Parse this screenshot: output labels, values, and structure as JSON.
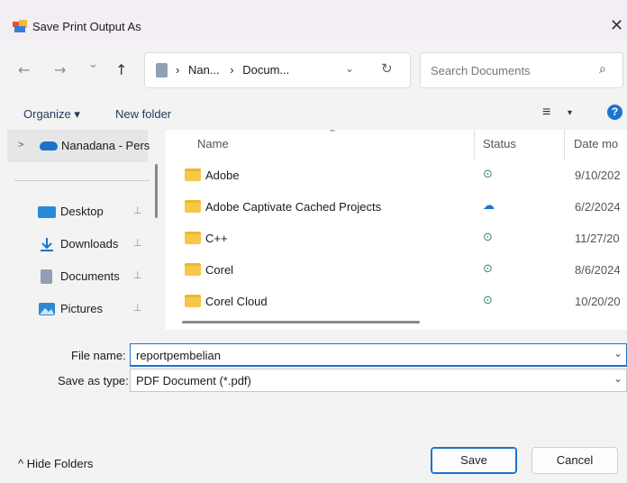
{
  "window": {
    "title": "Save Print Output As",
    "close_glyph": "✕"
  },
  "nav": {
    "back_glyph": "←",
    "forward_glyph": "→",
    "recent_glyph": "⌄",
    "up_glyph": "↑",
    "breadcrumb": [
      {
        "label": "Nan..."
      },
      {
        "label": "Docum..."
      }
    ],
    "separator": "›",
    "refresh_glyph": "↻",
    "dropdown_glyph": "⌄"
  },
  "search": {
    "placeholder": "Search Documents",
    "icon": "search-icon",
    "glyph": "⌕"
  },
  "commands": {
    "organize_label": "Organize ▾",
    "new_folder_label": "New folder",
    "view_glyph": "≡",
    "view_caret": "▾",
    "help_glyph": "?"
  },
  "sidebar": {
    "onedrive_label": "Nanadana - Pers",
    "expand_glyph": ">",
    "pin_glyph": "📌",
    "quick_access": [
      {
        "label": "Desktop",
        "icon": "desktop-icon",
        "color": "#2a8ad6"
      },
      {
        "label": "Downloads",
        "icon": "download-icon",
        "color": "#1a73c9"
      },
      {
        "label": "Documents",
        "icon": "documents-icon",
        "color": "#8fa0b5"
      },
      {
        "label": "Pictures",
        "icon": "pictures-icon",
        "color": "#2a8ad6"
      }
    ]
  },
  "columns": {
    "name": "Name",
    "status": "Status",
    "date": "Date mo",
    "sort_glyph": "⌃"
  },
  "files": [
    {
      "name": "Adobe",
      "status": "synced",
      "status_glyph": "⊙",
      "status_color": "#2e8b57",
      "date": "9/10/202"
    },
    {
      "name": "Adobe Captivate Cached Projects",
      "status": "cloud",
      "status_glyph": "☁",
      "status_color": "#1a73c9",
      "date": "6/2/2024"
    },
    {
      "name": "C++",
      "status": "synced",
      "status_glyph": "⊙",
      "status_color": "#2e8b57",
      "date": "11/27/20"
    },
    {
      "name": "Corel",
      "status": "synced",
      "status_glyph": "⊙",
      "status_color": "#2e8b57",
      "date": "8/6/2024"
    },
    {
      "name": "Corel Cloud",
      "status": "synced",
      "status_glyph": "⊙",
      "status_color": "#2e8b57",
      "date": "10/20/20"
    }
  ],
  "form": {
    "file_name_label": "File name:",
    "file_name_value": "reportpembelian",
    "save_type_label": "Save as type:",
    "save_type_value": "PDF Document (*.pdf)",
    "chevron_glyph": "⌄"
  },
  "footer": {
    "hide_folders_label": "^ Hide Folders",
    "save_label": "Save",
    "cancel_label": "Cancel"
  },
  "colors": {
    "accent": "#1a73c9",
    "folder": "#f7c74a"
  }
}
